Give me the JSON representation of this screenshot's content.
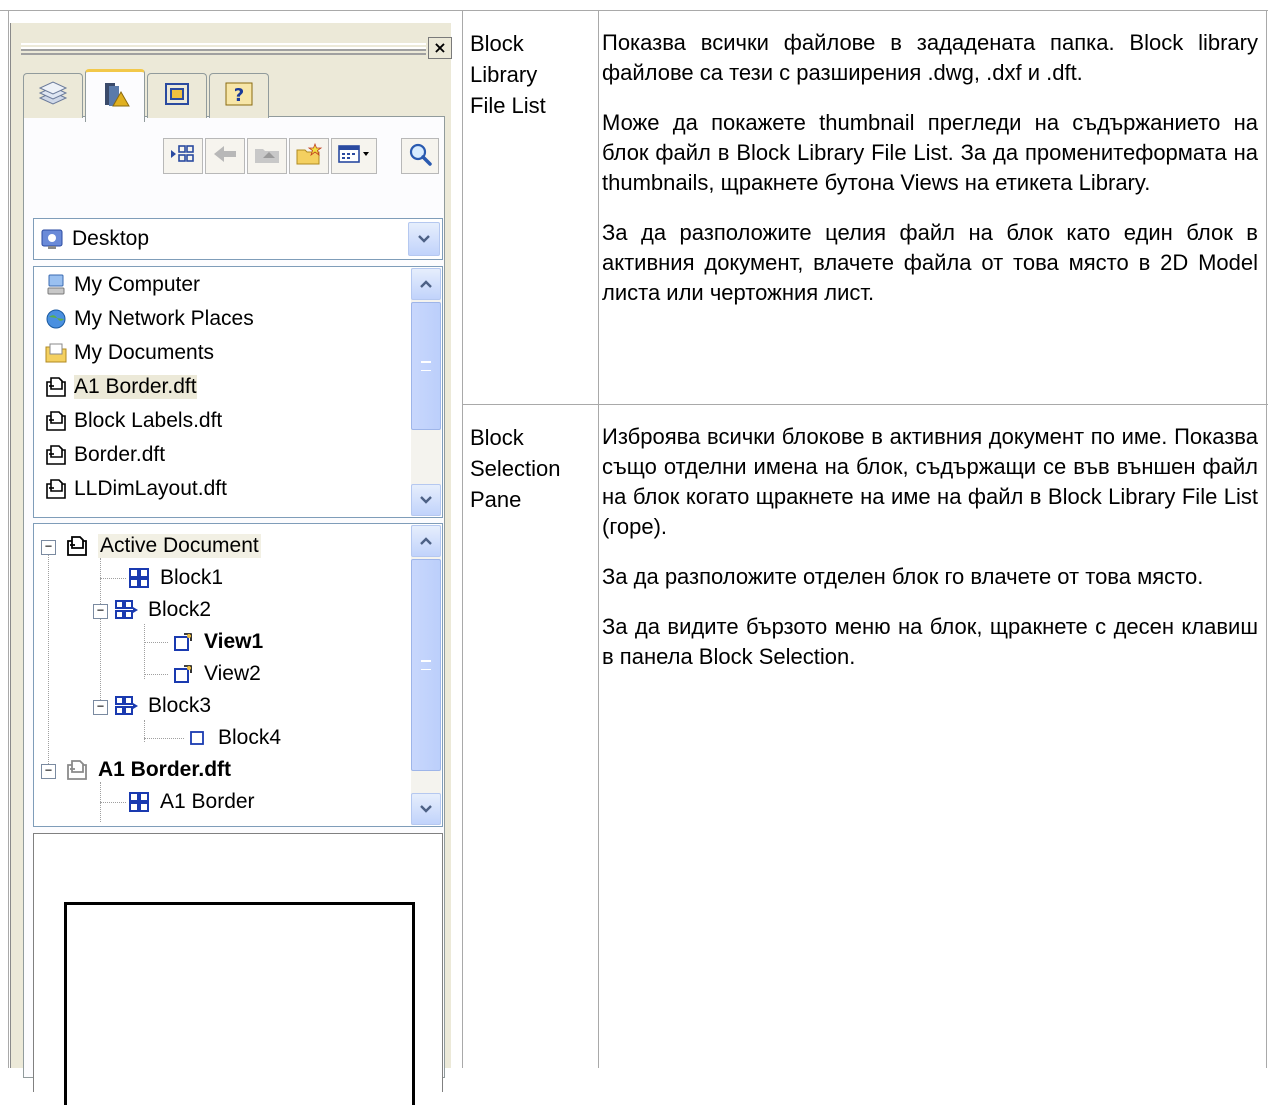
{
  "panel": {
    "close_glyph": "×",
    "tabs": [
      {
        "icon": "layers-icon"
      },
      {
        "icon": "library-icon",
        "active": true
      },
      {
        "icon": "view-icon"
      },
      {
        "icon": "properties-icon"
      }
    ],
    "toolbar": {
      "buttons": [
        "views-icon",
        "back-icon",
        "up-folder-icon",
        "new-folder-icon",
        "view-menu-icon"
      ],
      "search": "search-icon"
    },
    "location": {
      "value": "Desktop"
    },
    "file_list": {
      "items": [
        {
          "label": "My Computer",
          "icon": "computer-icon"
        },
        {
          "label": "My Network Places",
          "icon": "network-icon"
        },
        {
          "label": "My Documents",
          "icon": "documents-icon"
        },
        {
          "label": "A1 Border.dft",
          "icon": "dft-file-icon",
          "selected": true
        },
        {
          "label": "Block Labels.dft",
          "icon": "dft-file-icon"
        },
        {
          "label": "Border.dft",
          "icon": "dft-file-icon"
        },
        {
          "label": "LLDimLayout.dft",
          "icon": "dft-file-icon"
        }
      ]
    },
    "block_tree": {
      "items": [
        {
          "label": "Active Document",
          "icon": "document-icon"
        },
        {
          "label": "Block1",
          "icon": "block-icon"
        },
        {
          "label": "Block2",
          "icon": "block-views-icon"
        },
        {
          "label": "View1",
          "icon": "view-icon",
          "bold": true
        },
        {
          "label": "View2",
          "icon": "view-icon"
        },
        {
          "label": "Block3",
          "icon": "block-views-icon"
        },
        {
          "label": "Block4",
          "icon": "empty-block-icon"
        },
        {
          "label": "A1 Border.dft",
          "icon": "document-icon",
          "bold": true
        },
        {
          "label": "A1 Border",
          "icon": "block-icon"
        }
      ]
    }
  },
  "table": {
    "rows": [
      {
        "term": [
          "Block",
          "Library",
          "File List"
        ],
        "paragraphs": [
          "Показва всички файлове в зададената папка. Block library файлове са тези с разширения .dwg, .dxf и .dft.",
          "Може да покажете thumbnail прегледи на съдържанието на блок файл в Block Library File List. За да променитеформата на thumbnails, щракнете бутона Views на етикета Library.",
          "За да разположите целия файл на блок като един блок в активния документ, влачете файла от това място в 2D Model листа или чертожния лист."
        ]
      },
      {
        "term": [
          "Block",
          "Selection",
          "Pane"
        ],
        "paragraphs": [
          "Изброява всички блокове в активния документ по име. Показва също отделни имена на блок, съдържащи се във външен файл на блок когато щракнете на име на файл в Block Library File List (горе).",
          "За да разположите отделен блок го влачете от това място.",
          "За да видите бързото меню на блок, щракнете с десен клавиш в панела Block Selection."
        ]
      }
    ]
  },
  "colors": {
    "panel_bg": "#ece9d8",
    "list_border": "#7f9db9",
    "scrollbar_blue": "#c1d3fb",
    "grid_line": "#a9a9a9"
  }
}
